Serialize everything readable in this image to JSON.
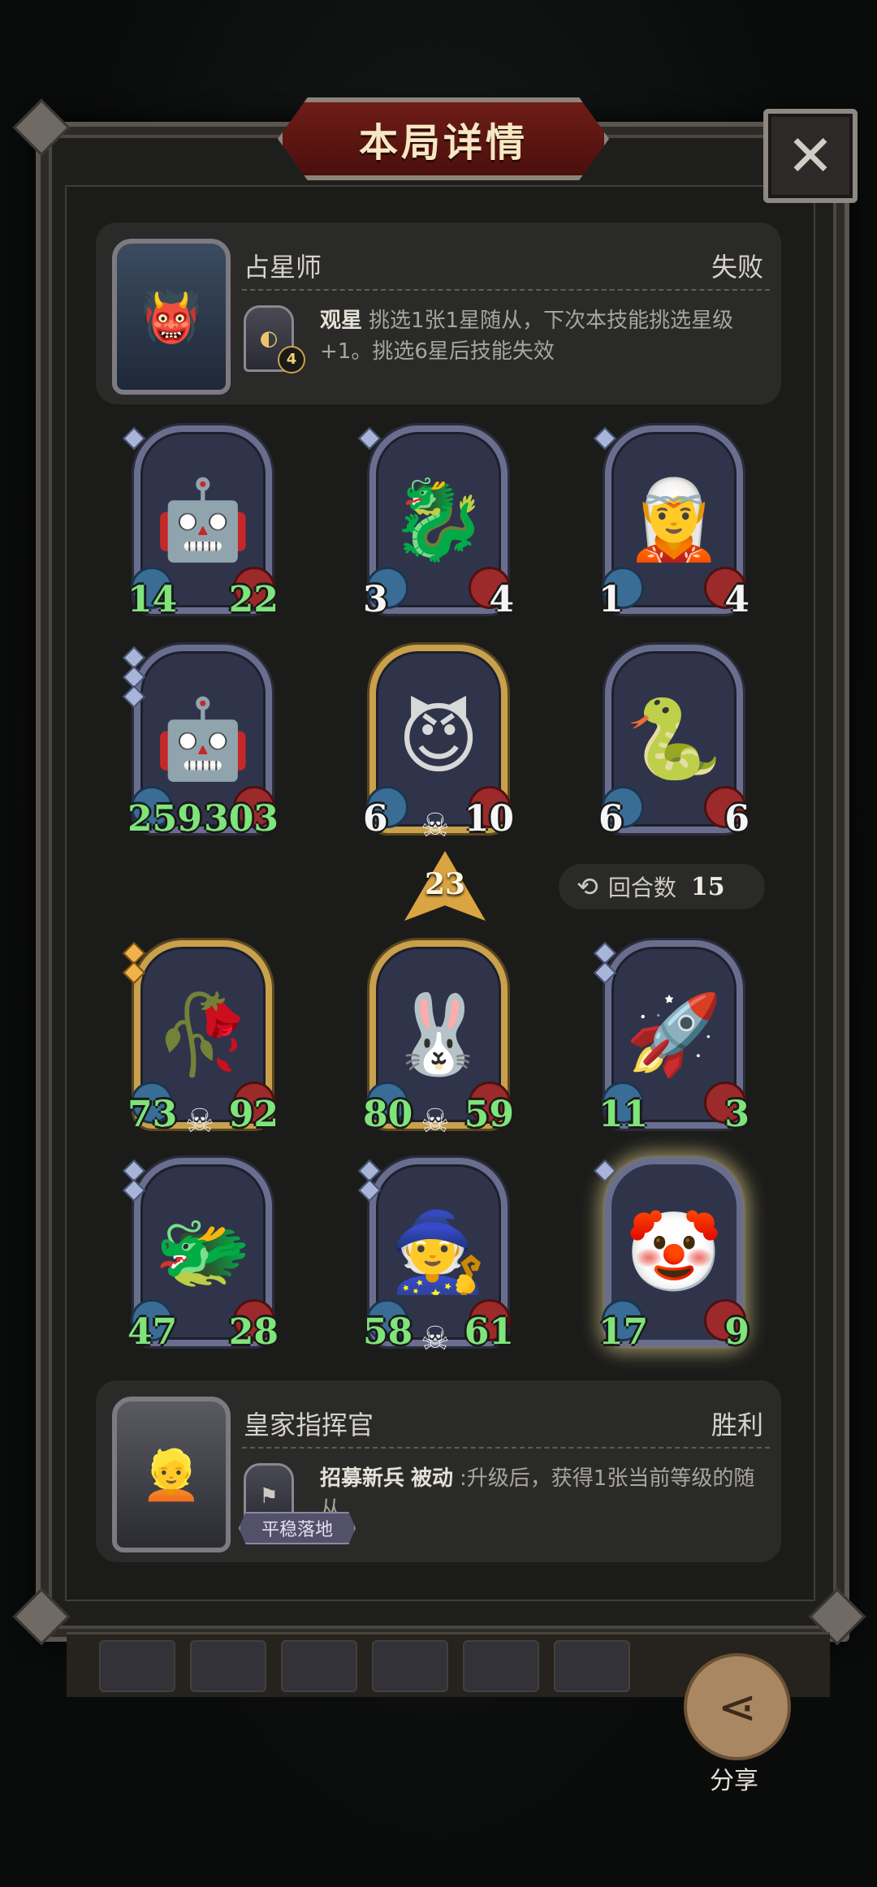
{
  "title": "本局详情",
  "close_icon": "close-icon",
  "opponent": {
    "hero_name": "占星师",
    "result": "失败",
    "skill_name": "观星",
    "skill_desc": "挑选1张1星随从，下次本技能挑选星级+1。挑选6星后技能失效",
    "skill_level": "4"
  },
  "opponent_board": [
    {
      "attack": "14",
      "health": "22",
      "stars": 1,
      "buffed": true
    },
    {
      "attack": "3",
      "health": "4",
      "stars": 1,
      "buffed": false
    },
    {
      "attack": "1",
      "health": "4",
      "stars": 1,
      "buffed": false
    },
    {
      "attack": "259",
      "health": "303",
      "stars": 3,
      "buffed": true
    },
    {
      "attack": "6",
      "health": "10",
      "stars": 0,
      "buffed": false
    },
    {
      "attack": "6",
      "health": "6",
      "stars": 0,
      "buffed": false
    }
  ],
  "tier": "23",
  "rounds": {
    "label": "回合数",
    "value": "15"
  },
  "player_board": [
    {
      "attack": "73",
      "health": "92",
      "stars": 2,
      "buffed": true
    },
    {
      "attack": "80",
      "health": "59",
      "stars": 0,
      "buffed": true
    },
    {
      "attack": "11",
      "health": "3",
      "stars": 2,
      "buffed": true
    },
    {
      "attack": "47",
      "health": "28",
      "stars": 2,
      "buffed": true
    },
    {
      "attack": "58",
      "health": "61",
      "stars": 2,
      "buffed": true
    },
    {
      "attack": "17",
      "health": "9",
      "stars": 1,
      "buffed": true
    }
  ],
  "player": {
    "hero_name": "皇家指挥官",
    "result": "胜利",
    "skill_name": "招募新兵",
    "skill_type": "被动",
    "skill_desc": ":升级后，获得1张当前等级的随从",
    "tag": "平稳落地"
  },
  "share": {
    "label": "分享",
    "icon": "share-icon"
  }
}
